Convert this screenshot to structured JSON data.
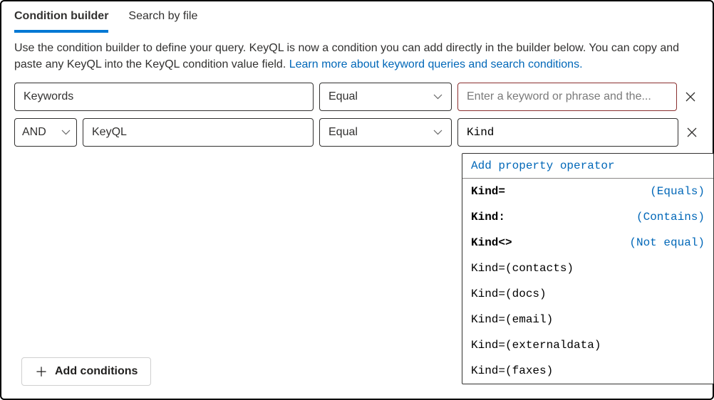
{
  "tabs": {
    "builder": "Condition builder",
    "byfile": "Search by file"
  },
  "description": {
    "text1": "Use the condition builder to define your query. KeyQL is now a condition you can add directly in the builder below. You can copy and paste any KeyQL into the KeyQL condition value field. ",
    "link": "Learn more about keyword queries and search conditions."
  },
  "row1": {
    "property": "Keywords",
    "operator": "Equal",
    "placeholder": "Enter a keyword or phrase and the..."
  },
  "row2": {
    "logic": "AND",
    "property": "KeyQL",
    "operator": "Equal",
    "value": "Kind"
  },
  "add": {
    "label": "Add conditions"
  },
  "panel": {
    "header": "Add property operator",
    "items": [
      {
        "left": "Kind=",
        "right": "(Equals)",
        "bold": true
      },
      {
        "left": "Kind:",
        "right": "(Contains)",
        "bold": true
      },
      {
        "left": "Kind<>",
        "right": "(Not equal)",
        "bold": true
      },
      {
        "left": "Kind=(contacts)",
        "right": "",
        "bold": false
      },
      {
        "left": "Kind=(docs)",
        "right": "",
        "bold": false
      },
      {
        "left": "Kind=(email)",
        "right": "",
        "bold": false
      },
      {
        "left": "Kind=(externaldata)",
        "right": "",
        "bold": false
      },
      {
        "left": "Kind=(faxes)",
        "right": "",
        "bold": false
      }
    ]
  }
}
